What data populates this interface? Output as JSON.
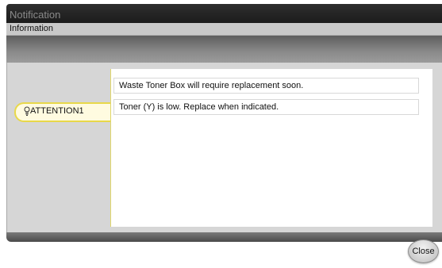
{
  "window": {
    "title": "Notification"
  },
  "header": {
    "subtitle": "Information"
  },
  "sidebar": {
    "attention_tab": {
      "label": "ATTENTION1",
      "icon": "lightbulb-icon",
      "accent_color": "#e8d84a",
      "background": "#fffbe0"
    }
  },
  "messages": [
    {
      "text": "Waste Toner Box will require replacement soon."
    },
    {
      "text": "Toner (Y) is low. Replace when indicated."
    }
  ],
  "footer": {
    "close_label": "Close"
  },
  "colors": {
    "title_bar": "#232323",
    "panel": "#d6d6d6",
    "message_bg": "#ffffff"
  }
}
